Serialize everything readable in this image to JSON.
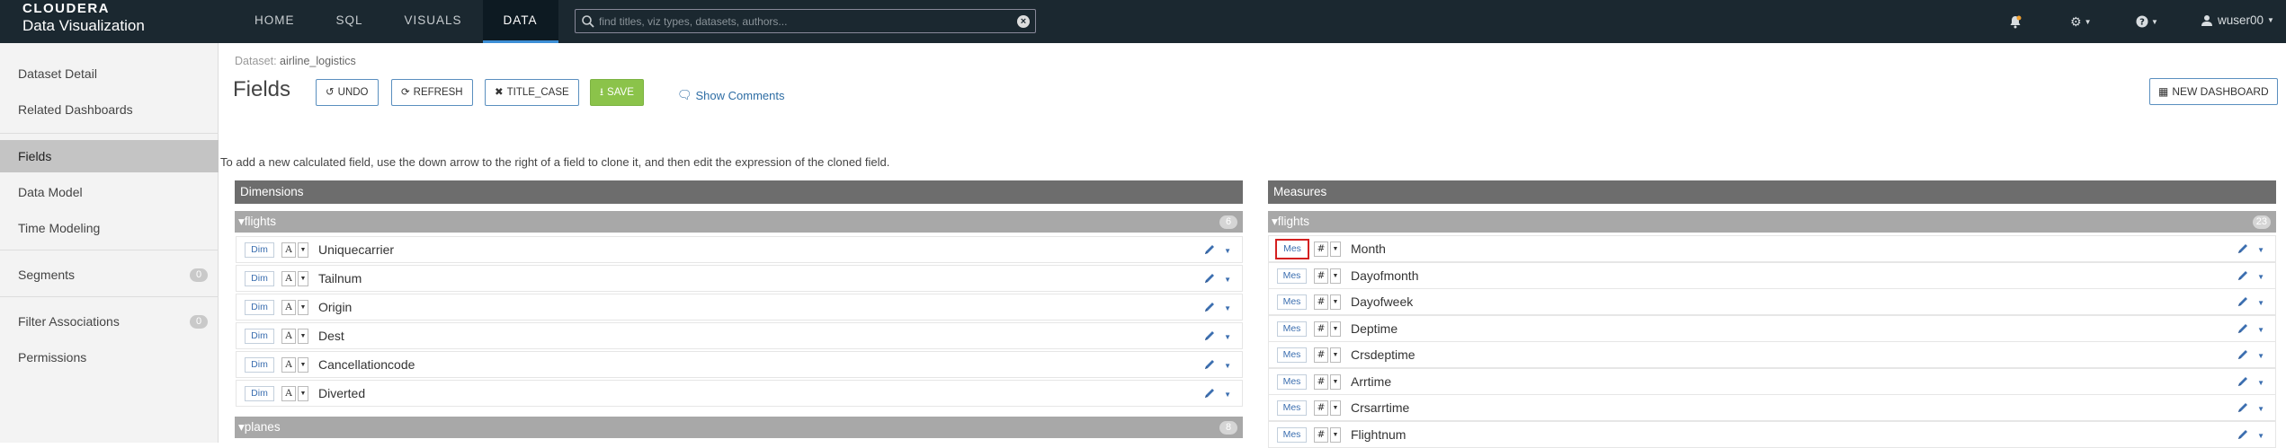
{
  "brand": {
    "line1": "CLOUDERA",
    "line2": "Data Visualization"
  },
  "nav": {
    "tabs": [
      "HOME",
      "SQL",
      "VISUALS",
      "DATA"
    ],
    "active": "DATA"
  },
  "search": {
    "placeholder": "find titles, viz types, datasets, authors...",
    "value": ""
  },
  "user": {
    "name": "wuser00"
  },
  "sidebar": {
    "items": [
      {
        "label": "Dataset Detail",
        "count": ""
      },
      {
        "label": "Related Dashboards",
        "count": ""
      },
      {
        "label": "Fields",
        "count": ""
      },
      {
        "label": "Data Model",
        "count": ""
      },
      {
        "label": "Time Modeling",
        "count": ""
      },
      {
        "label": "Segments",
        "count": "0"
      },
      {
        "label": "Filter Associations",
        "count": "0"
      },
      {
        "label": "Permissions",
        "count": ""
      }
    ],
    "active": "Fields"
  },
  "header": {
    "dataset_key": "Dataset:",
    "dataset_name": "airline_logistics",
    "title": "Fields",
    "undo": "UNDO",
    "refresh": "REFRESH",
    "title_case": "TITLE_CASE",
    "save": "SAVE",
    "show_comments": "Show Comments",
    "new_dashboard": "NEW DASHBOARD"
  },
  "hint": "To add a new calculated field, use the down arrow to the right of a field to clone it, and then edit the expression of the cloned field.",
  "dimensions": {
    "title": "Dimensions",
    "groups": [
      {
        "name": "flights",
        "count": "6",
        "fields": [
          {
            "role": "Dim",
            "type": "A",
            "name": "Uniquecarrier"
          },
          {
            "role": "Dim",
            "type": "A",
            "name": "Tailnum"
          },
          {
            "role": "Dim",
            "type": "A",
            "name": "Origin"
          },
          {
            "role": "Dim",
            "type": "A",
            "name": "Dest"
          },
          {
            "role": "Dim",
            "type": "A",
            "name": "Cancellationcode"
          },
          {
            "role": "Dim",
            "type": "A",
            "name": "Diverted"
          }
        ]
      },
      {
        "name": "planes",
        "count": "8",
        "fields": []
      }
    ]
  },
  "measures": {
    "title": "Measures",
    "groups": [
      {
        "name": "flights",
        "count": "23",
        "fields": [
          {
            "role": "Mes",
            "type": "#",
            "name": "Month"
          },
          {
            "role": "Mes",
            "type": "#",
            "name": "Dayofmonth"
          },
          {
            "role": "Mes",
            "type": "#",
            "name": "Dayofweek"
          },
          {
            "role": "Mes",
            "type": "#",
            "name": "Deptime"
          },
          {
            "role": "Mes",
            "type": "#",
            "name": "Crsdeptime"
          },
          {
            "role": "Mes",
            "type": "#",
            "name": "Arrtime"
          },
          {
            "role": "Mes",
            "type": "#",
            "name": "Crsarrtime"
          },
          {
            "role": "Mes",
            "type": "#",
            "name": "Flightnum"
          }
        ]
      }
    ]
  },
  "colors": {
    "topbar": "#1b2830",
    "accent": "#3d8fd6",
    "save": "#8bc34a",
    "highlight": "#d42020"
  }
}
